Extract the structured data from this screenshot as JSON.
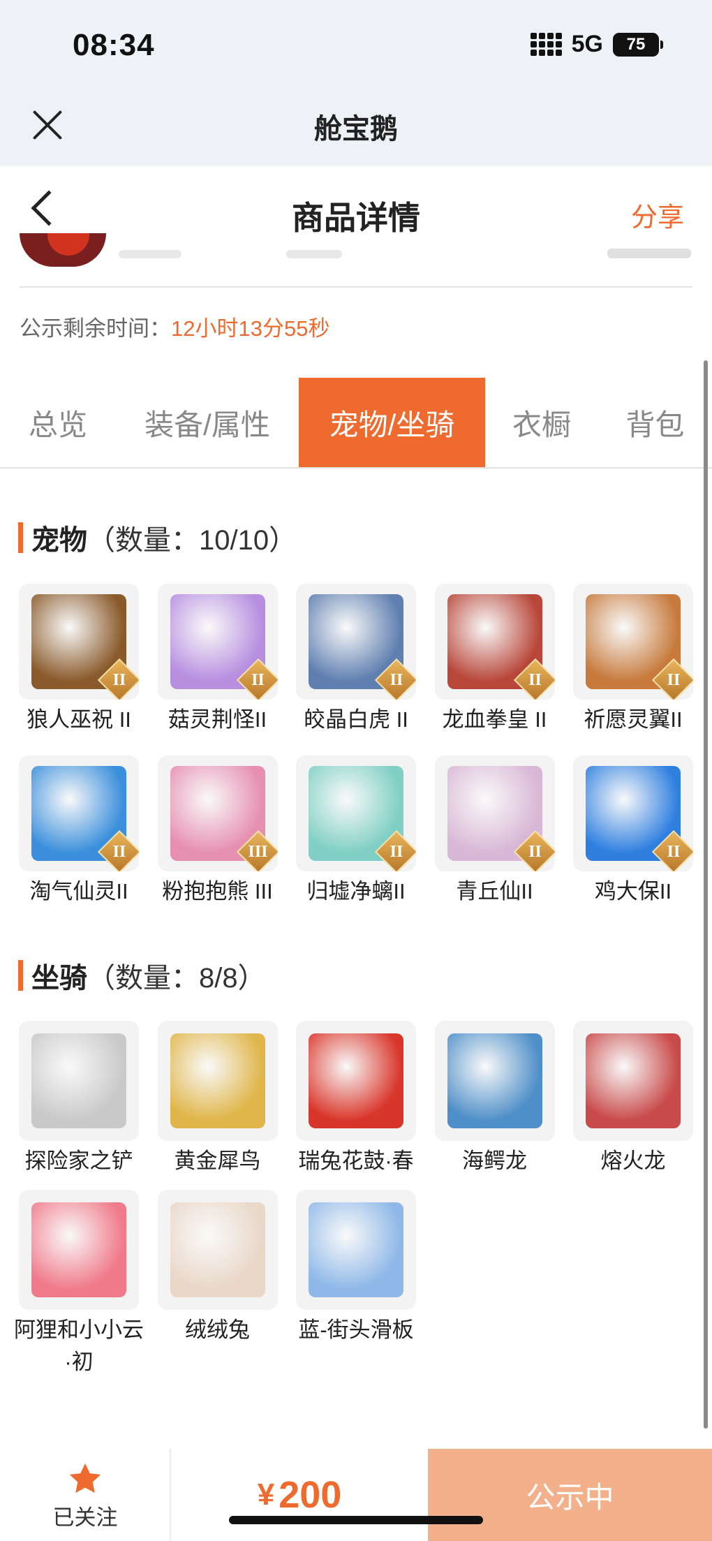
{
  "status_bar": {
    "time": "08:34",
    "network": "5G",
    "battery": "75"
  },
  "mini_program": {
    "title": "舱宝鹅"
  },
  "header": {
    "title": "商品详情",
    "share_label": "分享"
  },
  "countdown": {
    "label": "公示剩余时间：",
    "value": "12小时13分55秒"
  },
  "tabs": [
    {
      "label": "总览",
      "active": false
    },
    {
      "label": "装备/属性",
      "active": false
    },
    {
      "label": "宠物/坐骑",
      "active": true
    },
    {
      "label": "衣橱",
      "active": false
    },
    {
      "label": "背包",
      "active": false
    }
  ],
  "pets": {
    "title": "宠物",
    "count": "（数量：10/10）",
    "items": [
      {
        "name": "狼人巫祝 II",
        "badge": "II",
        "color": "#8a5a2b",
        "icon": "werewolf-icon"
      },
      {
        "name": "菇灵荆怪II",
        "badge": "II",
        "color": "#b78ee0",
        "icon": "mushroom-spirit-icon"
      },
      {
        "name": "皎晶白虎 II",
        "badge": "II",
        "color": "#5f7fb0",
        "icon": "white-tiger-icon"
      },
      {
        "name": "龙血拳皇 II",
        "badge": "II",
        "color": "#b8473a",
        "icon": "dragon-boxer-icon"
      },
      {
        "name": "祈愿灵翼II",
        "badge": "II",
        "color": "#c77a3c",
        "icon": "spirit-wing-bird-icon"
      },
      {
        "name": "淘气仙灵II",
        "badge": "II",
        "color": "#3b8fdc",
        "icon": "naughty-sprite-icon"
      },
      {
        "name": "粉抱抱熊 III",
        "badge": "III",
        "color": "#e68fb0",
        "icon": "pink-bear-icon"
      },
      {
        "name": "归墟净螭II",
        "badge": "II",
        "color": "#7fcfc4",
        "icon": "sea-dragon-icon"
      },
      {
        "name": "青丘仙II",
        "badge": "II",
        "color": "#d9b7d6",
        "icon": "fox-fairy-icon"
      },
      {
        "name": "鸡大保II",
        "badge": "II",
        "color": "#2f7fe0",
        "icon": "chicken-boss-icon"
      }
    ]
  },
  "mounts": {
    "title": "坐骑",
    "count": "（数量：8/8）",
    "items": [
      {
        "name": "探险家之铲",
        "color": "#c9c9c9",
        "icon": "shovel-icon"
      },
      {
        "name": "黄金犀鸟",
        "color": "#e0b64a",
        "icon": "hornbill-icon"
      },
      {
        "name": "瑞兔花鼓·春",
        "color": "#d9362b",
        "icon": "rabbit-drum-icon"
      },
      {
        "name": "海鳄龙",
        "color": "#4f8fc9",
        "icon": "sea-crocodile-dragon-icon"
      },
      {
        "name": "熔火龙",
        "color": "#c94a4a",
        "icon": "lava-dragon-icon"
      },
      {
        "name": "阿狸和小小云·初",
        "color": "#f07a8a",
        "icon": "ali-cloud-icon"
      },
      {
        "name": "绒绒兔",
        "color": "#e9d7c8",
        "icon": "fluffy-rabbit-icon"
      },
      {
        "name": "蓝-街头滑板",
        "color": "#8fb8e8",
        "icon": "skateboard-icon"
      }
    ]
  },
  "bottom_bar": {
    "follow_label": "已关注",
    "currency": "¥",
    "price": "200",
    "cta_label": "公示中"
  },
  "colors": {
    "accent": "#ee6a2f",
    "cta_bg": "#f2b08b"
  }
}
